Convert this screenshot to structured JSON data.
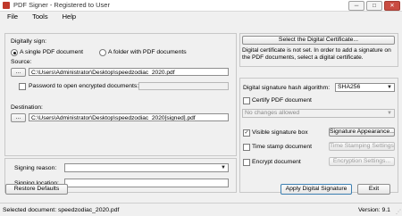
{
  "window": {
    "title": "PDF Signer - Registered to User",
    "minimize": "─",
    "maximize": "□",
    "close": "✕"
  },
  "menu": [
    "File",
    "Tools",
    "Help"
  ],
  "left": {
    "digitally_sign_label": "Digitally sign:",
    "radio_single": "A single PDF document",
    "radio_folder": "A folder with PDF documents",
    "selected_mode": "single",
    "source_label": "Source:",
    "browse_label": "...",
    "source_path": "C:\\Users\\Administrator\\Desktop\\speedzodiac_2020.pdf",
    "password_label": "Password to open encrypted documents:",
    "password_checked": false,
    "password_value": "",
    "destination_label": "Destination:",
    "destination_path": "C:\\Users\\Administrator\\Desktop\\speedzodiac_2020[signed].pdf",
    "reason_label": "Signing reason:",
    "reason_value": "",
    "location_label": "Signing location:",
    "location_value": ""
  },
  "right": {
    "select_cert_button": "Select the Digital Certificate...",
    "cert_message": "Digital certificate is not set. In order to add a signature on the PDF documents, select a digital certificate.",
    "hash_label": "Digital signature hash algorithm:",
    "hash_value": "SHA256",
    "certify_label": "Certify PDF document",
    "certify_checked": false,
    "certify_option": "No changes allowed",
    "visible_sig_label": "Visible signature box",
    "visible_sig_checked": true,
    "sig_appearance_button": "Signature Appearance...",
    "timestamp_label": "Time stamp document",
    "timestamp_checked": false,
    "timestamp_button": "Time Stamping Settings...",
    "encrypt_label": "Encrypt document",
    "encrypt_checked": false,
    "encrypt_button": "Encryption Settings..."
  },
  "footer": {
    "restore_button": "Restore Defaults",
    "apply_button": "Apply Digital Signature",
    "exit_button": "Exit"
  },
  "status": {
    "selected_doc": "Selected document: speedzodiac_2020.pdf",
    "version": "Version: 9.1"
  },
  "glyphs": {
    "dropdown": "▼",
    "check": "✓",
    "grip": "⋰"
  }
}
